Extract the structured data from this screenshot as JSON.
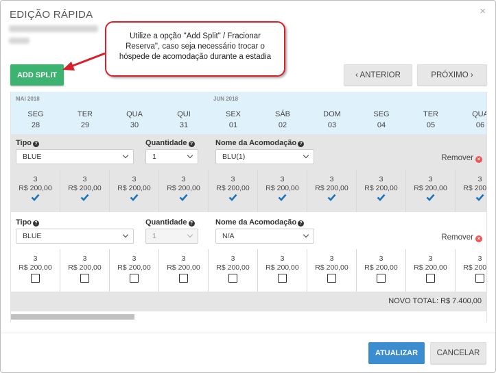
{
  "modal": {
    "title": "EDIÇÃO RÁPIDA",
    "close_label": "×"
  },
  "callout": {
    "text": "Utilize a opção \"Add Split\" / Fracionar Reserva\", caso seja necessário trocar o hóspede de acomodação durante a estadia"
  },
  "toolbar": {
    "add_split": "ADD SPLIT",
    "prev": "‹  ANTERIOR",
    "next": "PRÓXIMO  ›"
  },
  "months": [
    "MAI 2018",
    "JUN 2018"
  ],
  "days": [
    {
      "dow": "SEG",
      "num": "28"
    },
    {
      "dow": "TER",
      "num": "29"
    },
    {
      "dow": "QUA",
      "num": "30"
    },
    {
      "dow": "QUI",
      "num": "31"
    },
    {
      "dow": "SEX",
      "num": "01"
    },
    {
      "dow": "SÁB",
      "num": "02"
    },
    {
      "dow": "DOM",
      "num": "03"
    },
    {
      "dow": "SEG",
      "num": "04"
    },
    {
      "dow": "TER",
      "num": "05"
    },
    {
      "dow": "QUA",
      "num": "06"
    }
  ],
  "labels": {
    "tipo": "Tipo",
    "quantidade": "Quantidade",
    "acomodacao": "Nome da Acomodação",
    "remover": "Remover"
  },
  "splits": [
    {
      "tipo": "BLUE",
      "quantidade": "1",
      "acomodacao": "BLU(1)",
      "checked": true
    },
    {
      "tipo": "BLUE",
      "quantidade": "1",
      "acomodacao": "N/A",
      "checked": false
    }
  ],
  "cell": {
    "qty": "3",
    "price": "R$ 200,00"
  },
  "total": "NOVO TOTAL: R$ 7.400,00",
  "footer": {
    "update": "ATUALIZAR",
    "cancel": "CANCELAR"
  },
  "colors": {
    "accent_green": "#3cb371",
    "accent_blue": "#3c8dd0",
    "check_blue": "#1e73be",
    "callout_red": "#d9202a"
  }
}
